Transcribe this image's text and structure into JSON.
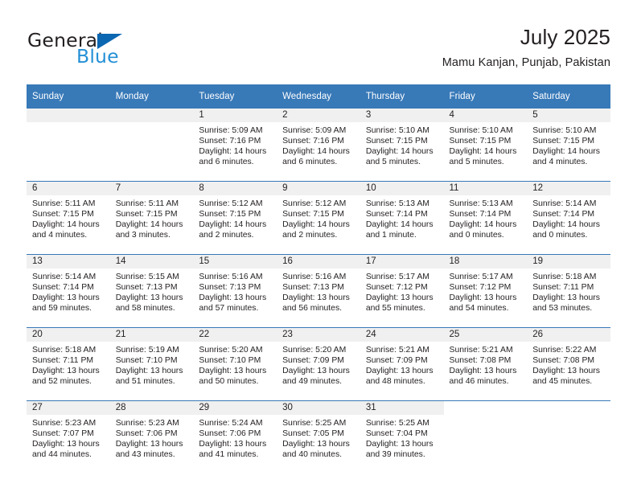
{
  "brand": {
    "name_part1": "General",
    "name_part2": "Blue"
  },
  "header": {
    "title": "July 2025",
    "location": "Mamu Kanjan, Punjab, Pakistan"
  },
  "colors": {
    "header_blue": "#3879b8",
    "brand_blue": "#2490d6",
    "triangle_blue": "#0b67b2",
    "daynum_band": "#f0f0f0",
    "text": "#231f20"
  },
  "weekdays": [
    "Sunday",
    "Monday",
    "Tuesday",
    "Wednesday",
    "Thursday",
    "Friday",
    "Saturday"
  ],
  "labels": {
    "sunrise_prefix": "Sunrise:",
    "sunset_prefix": "Sunset:",
    "daylight_prefix": "Daylight:"
  },
  "weeks": [
    [
      {
        "day": "",
        "blank": true
      },
      {
        "day": "",
        "blank": true
      },
      {
        "day": "1",
        "sunrise": "Sunrise: 5:09 AM",
        "sunset": "Sunset: 7:16 PM",
        "daylight": "Daylight: 14 hours and 6 minutes."
      },
      {
        "day": "2",
        "sunrise": "Sunrise: 5:09 AM",
        "sunset": "Sunset: 7:16 PM",
        "daylight": "Daylight: 14 hours and 6 minutes."
      },
      {
        "day": "3",
        "sunrise": "Sunrise: 5:10 AM",
        "sunset": "Sunset: 7:15 PM",
        "daylight": "Daylight: 14 hours and 5 minutes."
      },
      {
        "day": "4",
        "sunrise": "Sunrise: 5:10 AM",
        "sunset": "Sunset: 7:15 PM",
        "daylight": "Daylight: 14 hours and 5 minutes."
      },
      {
        "day": "5",
        "sunrise": "Sunrise: 5:10 AM",
        "sunset": "Sunset: 7:15 PM",
        "daylight": "Daylight: 14 hours and 4 minutes."
      }
    ],
    [
      {
        "day": "6",
        "sunrise": "Sunrise: 5:11 AM",
        "sunset": "Sunset: 7:15 PM",
        "daylight": "Daylight: 14 hours and 4 minutes."
      },
      {
        "day": "7",
        "sunrise": "Sunrise: 5:11 AM",
        "sunset": "Sunset: 7:15 PM",
        "daylight": "Daylight: 14 hours and 3 minutes."
      },
      {
        "day": "8",
        "sunrise": "Sunrise: 5:12 AM",
        "sunset": "Sunset: 7:15 PM",
        "daylight": "Daylight: 14 hours and 2 minutes."
      },
      {
        "day": "9",
        "sunrise": "Sunrise: 5:12 AM",
        "sunset": "Sunset: 7:15 PM",
        "daylight": "Daylight: 14 hours and 2 minutes."
      },
      {
        "day": "10",
        "sunrise": "Sunrise: 5:13 AM",
        "sunset": "Sunset: 7:14 PM",
        "daylight": "Daylight: 14 hours and 1 minute."
      },
      {
        "day": "11",
        "sunrise": "Sunrise: 5:13 AM",
        "sunset": "Sunset: 7:14 PM",
        "daylight": "Daylight: 14 hours and 0 minutes."
      },
      {
        "day": "12",
        "sunrise": "Sunrise: 5:14 AM",
        "sunset": "Sunset: 7:14 PM",
        "daylight": "Daylight: 14 hours and 0 minutes."
      }
    ],
    [
      {
        "day": "13",
        "sunrise": "Sunrise: 5:14 AM",
        "sunset": "Sunset: 7:14 PM",
        "daylight": "Daylight: 13 hours and 59 minutes."
      },
      {
        "day": "14",
        "sunrise": "Sunrise: 5:15 AM",
        "sunset": "Sunset: 7:13 PM",
        "daylight": "Daylight: 13 hours and 58 minutes."
      },
      {
        "day": "15",
        "sunrise": "Sunrise: 5:16 AM",
        "sunset": "Sunset: 7:13 PM",
        "daylight": "Daylight: 13 hours and 57 minutes."
      },
      {
        "day": "16",
        "sunrise": "Sunrise: 5:16 AM",
        "sunset": "Sunset: 7:13 PM",
        "daylight": "Daylight: 13 hours and 56 minutes."
      },
      {
        "day": "17",
        "sunrise": "Sunrise: 5:17 AM",
        "sunset": "Sunset: 7:12 PM",
        "daylight": "Daylight: 13 hours and 55 minutes."
      },
      {
        "day": "18",
        "sunrise": "Sunrise: 5:17 AM",
        "sunset": "Sunset: 7:12 PM",
        "daylight": "Daylight: 13 hours and 54 minutes."
      },
      {
        "day": "19",
        "sunrise": "Sunrise: 5:18 AM",
        "sunset": "Sunset: 7:11 PM",
        "daylight": "Daylight: 13 hours and 53 minutes."
      }
    ],
    [
      {
        "day": "20",
        "sunrise": "Sunrise: 5:18 AM",
        "sunset": "Sunset: 7:11 PM",
        "daylight": "Daylight: 13 hours and 52 minutes."
      },
      {
        "day": "21",
        "sunrise": "Sunrise: 5:19 AM",
        "sunset": "Sunset: 7:10 PM",
        "daylight": "Daylight: 13 hours and 51 minutes."
      },
      {
        "day": "22",
        "sunrise": "Sunrise: 5:20 AM",
        "sunset": "Sunset: 7:10 PM",
        "daylight": "Daylight: 13 hours and 50 minutes."
      },
      {
        "day": "23",
        "sunrise": "Sunrise: 5:20 AM",
        "sunset": "Sunset: 7:09 PM",
        "daylight": "Daylight: 13 hours and 49 minutes."
      },
      {
        "day": "24",
        "sunrise": "Sunrise: 5:21 AM",
        "sunset": "Sunset: 7:09 PM",
        "daylight": "Daylight: 13 hours and 48 minutes."
      },
      {
        "day": "25",
        "sunrise": "Sunrise: 5:21 AM",
        "sunset": "Sunset: 7:08 PM",
        "daylight": "Daylight: 13 hours and 46 minutes."
      },
      {
        "day": "26",
        "sunrise": "Sunrise: 5:22 AM",
        "sunset": "Sunset: 7:08 PM",
        "daylight": "Daylight: 13 hours and 45 minutes."
      }
    ],
    [
      {
        "day": "27",
        "sunrise": "Sunrise: 5:23 AM",
        "sunset": "Sunset: 7:07 PM",
        "daylight": "Daylight: 13 hours and 44 minutes."
      },
      {
        "day": "28",
        "sunrise": "Sunrise: 5:23 AM",
        "sunset": "Sunset: 7:06 PM",
        "daylight": "Daylight: 13 hours and 43 minutes."
      },
      {
        "day": "29",
        "sunrise": "Sunrise: 5:24 AM",
        "sunset": "Sunset: 7:06 PM",
        "daylight": "Daylight: 13 hours and 41 minutes."
      },
      {
        "day": "30",
        "sunrise": "Sunrise: 5:25 AM",
        "sunset": "Sunset: 7:05 PM",
        "daylight": "Daylight: 13 hours and 40 minutes."
      },
      {
        "day": "31",
        "sunrise": "Sunrise: 5:25 AM",
        "sunset": "Sunset: 7:04 PM",
        "daylight": "Daylight: 13 hours and 39 minutes."
      },
      {
        "day": "",
        "blank": true,
        "outmonth": true
      },
      {
        "day": "",
        "blank": true,
        "outmonth": true
      }
    ]
  ]
}
